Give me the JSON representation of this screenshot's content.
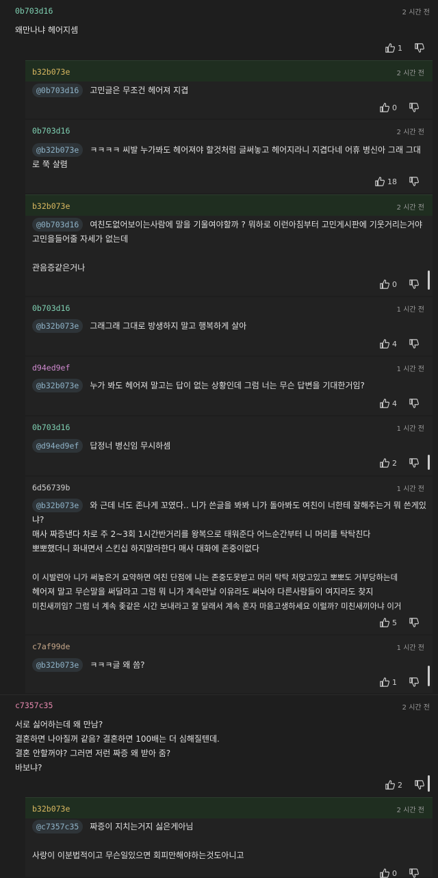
{
  "comments": [
    {
      "id": "c1",
      "author": "0b703d16",
      "author_color": "#7fd1b3",
      "time": "2 시간 전",
      "lines": [
        "왜만나냐 헤어지셈"
      ],
      "likes": "1"
    },
    {
      "id": "c2",
      "author": "b32b073e",
      "author_color": "#d9b860",
      "time": "2 시간 전",
      "mention": "@0b703d16",
      "lines": [
        "고민글은 무조건 헤어져 지겹"
      ],
      "likes": "0"
    },
    {
      "id": "c3",
      "author": "0b703d16",
      "author_color": "#7fd1b3",
      "time": "2 시간 전",
      "mention": "@b32b073e",
      "lines": [
        "ㅋㅋㅋㅋ 씨발 누가봐도 헤어져야 할것처럼 글써놓고 헤어지라니 지겹다네 어휴 병신아 그래 그대",
        "로 쭉 살렴"
      ],
      "likes": "18"
    },
    {
      "id": "c4",
      "author": "b32b073e",
      "author_color": "#d9b860",
      "time": "2 시간 전",
      "mention": "@0b703d16",
      "lines": [
        "여친도없어보이는사람에 말을 기울여야할까 ? 뭐하로 이런아침부터 고민게시판에 기웃거리는거야",
        "고민을들어줄 자세가 없는데",
        "",
        "관음증같은거나"
      ],
      "likes": "0"
    },
    {
      "id": "c5",
      "author": "0b703d16",
      "author_color": "#7fd1b3",
      "time": "1 시간 전",
      "mention": "@b32b073e",
      "lines": [
        "그래그래 그대로 방생하지 말고 행복하게 살아"
      ],
      "likes": "4"
    },
    {
      "id": "c6",
      "author": "d94ed9ef",
      "author_color": "#d08ad0",
      "time": "1 시간 전",
      "mention": "@b32b073e",
      "lines": [
        "누가 봐도 헤어져 말고는 답이 없는 상황인데 그럼 너는 무슨 답변을 기대한거임?"
      ],
      "likes": "4"
    },
    {
      "id": "c7",
      "author": "0b703d16",
      "author_color": "#7fd1b3",
      "time": "1 시간 전",
      "mention": "@d94ed9ef",
      "lines": [
        "답정너 병신임 무시하셈"
      ],
      "likes": "2"
    },
    {
      "id": "c8",
      "author": "6d56739b",
      "author_color": "#cfcfcf",
      "time": "1 시간 전",
      "mention": "@b32b073e",
      "lines": [
        "와 근데 너도 존나게 꼬였다.. 니가 쓴글을 봐봐 니가 돌아봐도 여친이 너한테 잘해주는거 뭐 쓴게있",
        "냐?",
        "매사 짜증낸다 차로 주 2~3회 1시간반거리를 왕복으로 태워준다 어느순간부터 니 머리를 탁탁친다",
        "뽀뽀했더니 화내면서 스킨십 하지말라한다 매사 대화에 존중이없다",
        "",
        "이 시발련아 니가 써놓은거 요약하면 여친 단점에 니는 존중도못받고 머리 탁탁 처맞고있고 뽀뽀도 거부당하는데",
        "헤어져 말고 무슨말을 써달라고 그럼 뭐 니가 계속만날 이유라도 써놔야 다른사람들이 여지라도 찾지",
        "미친새끼임? 그럼 너 계속 좆같은 시간 보내라고 잘 달래서 계속 혼자 마음고생하세요 이럴까? 미친새끼아냐 이거"
      ],
      "likes": "5"
    },
    {
      "id": "c9",
      "author": "c7af99de",
      "author_color": "#c7a88a",
      "time": "1 시간 전",
      "mention": "@b32b073e",
      "lines": [
        "ㅋㅋㅋ글 왜 씀?"
      ],
      "likes": "1"
    },
    {
      "id": "c10",
      "author": "c7357c35",
      "author_color": "#e88ab0",
      "time": "2 시간 전",
      "lines": [
        "서로 싫어하는데 왜 만남?",
        "결혼하면 나아질꺼 같음? 결혼하면 100배는 더 심해질텐데.",
        "결혼 안할꺼야? 그러면 저런 짜증 왜 받아 줌?",
        "바보냐?"
      ],
      "likes": "2"
    },
    {
      "id": "c11",
      "author": "b32b073e",
      "author_color": "#d9b860",
      "time": "2 시간 전",
      "mention": "@c7357c35",
      "lines": [
        "짜증이 지치는거지 싫은게아님",
        "",
        "사랑이 이분법적이고 무슨일있으면 회피만해야하는것도아니고"
      ],
      "likes": "0"
    }
  ]
}
